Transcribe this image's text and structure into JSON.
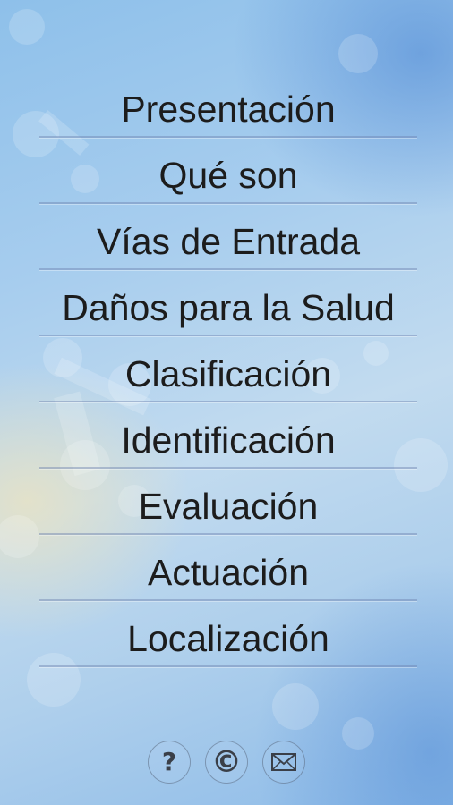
{
  "menu": {
    "items": [
      {
        "label": "Presentación"
      },
      {
        "label": "Qué son"
      },
      {
        "label": "Vías de Entrada"
      },
      {
        "label": "Daños para la Salud"
      },
      {
        "label": "Clasificación"
      },
      {
        "label": "Identificación"
      },
      {
        "label": "Evaluación"
      },
      {
        "label": "Actuación"
      },
      {
        "label": "Localización"
      }
    ]
  },
  "footer": {
    "help_glyph": "?",
    "copyright_glyph": "©",
    "icons": [
      "help-icon",
      "copyright-icon",
      "mail-icon"
    ]
  },
  "colors": {
    "text": "#1c1c1c",
    "divider": "#6e82af",
    "background": "#a7cdee"
  }
}
